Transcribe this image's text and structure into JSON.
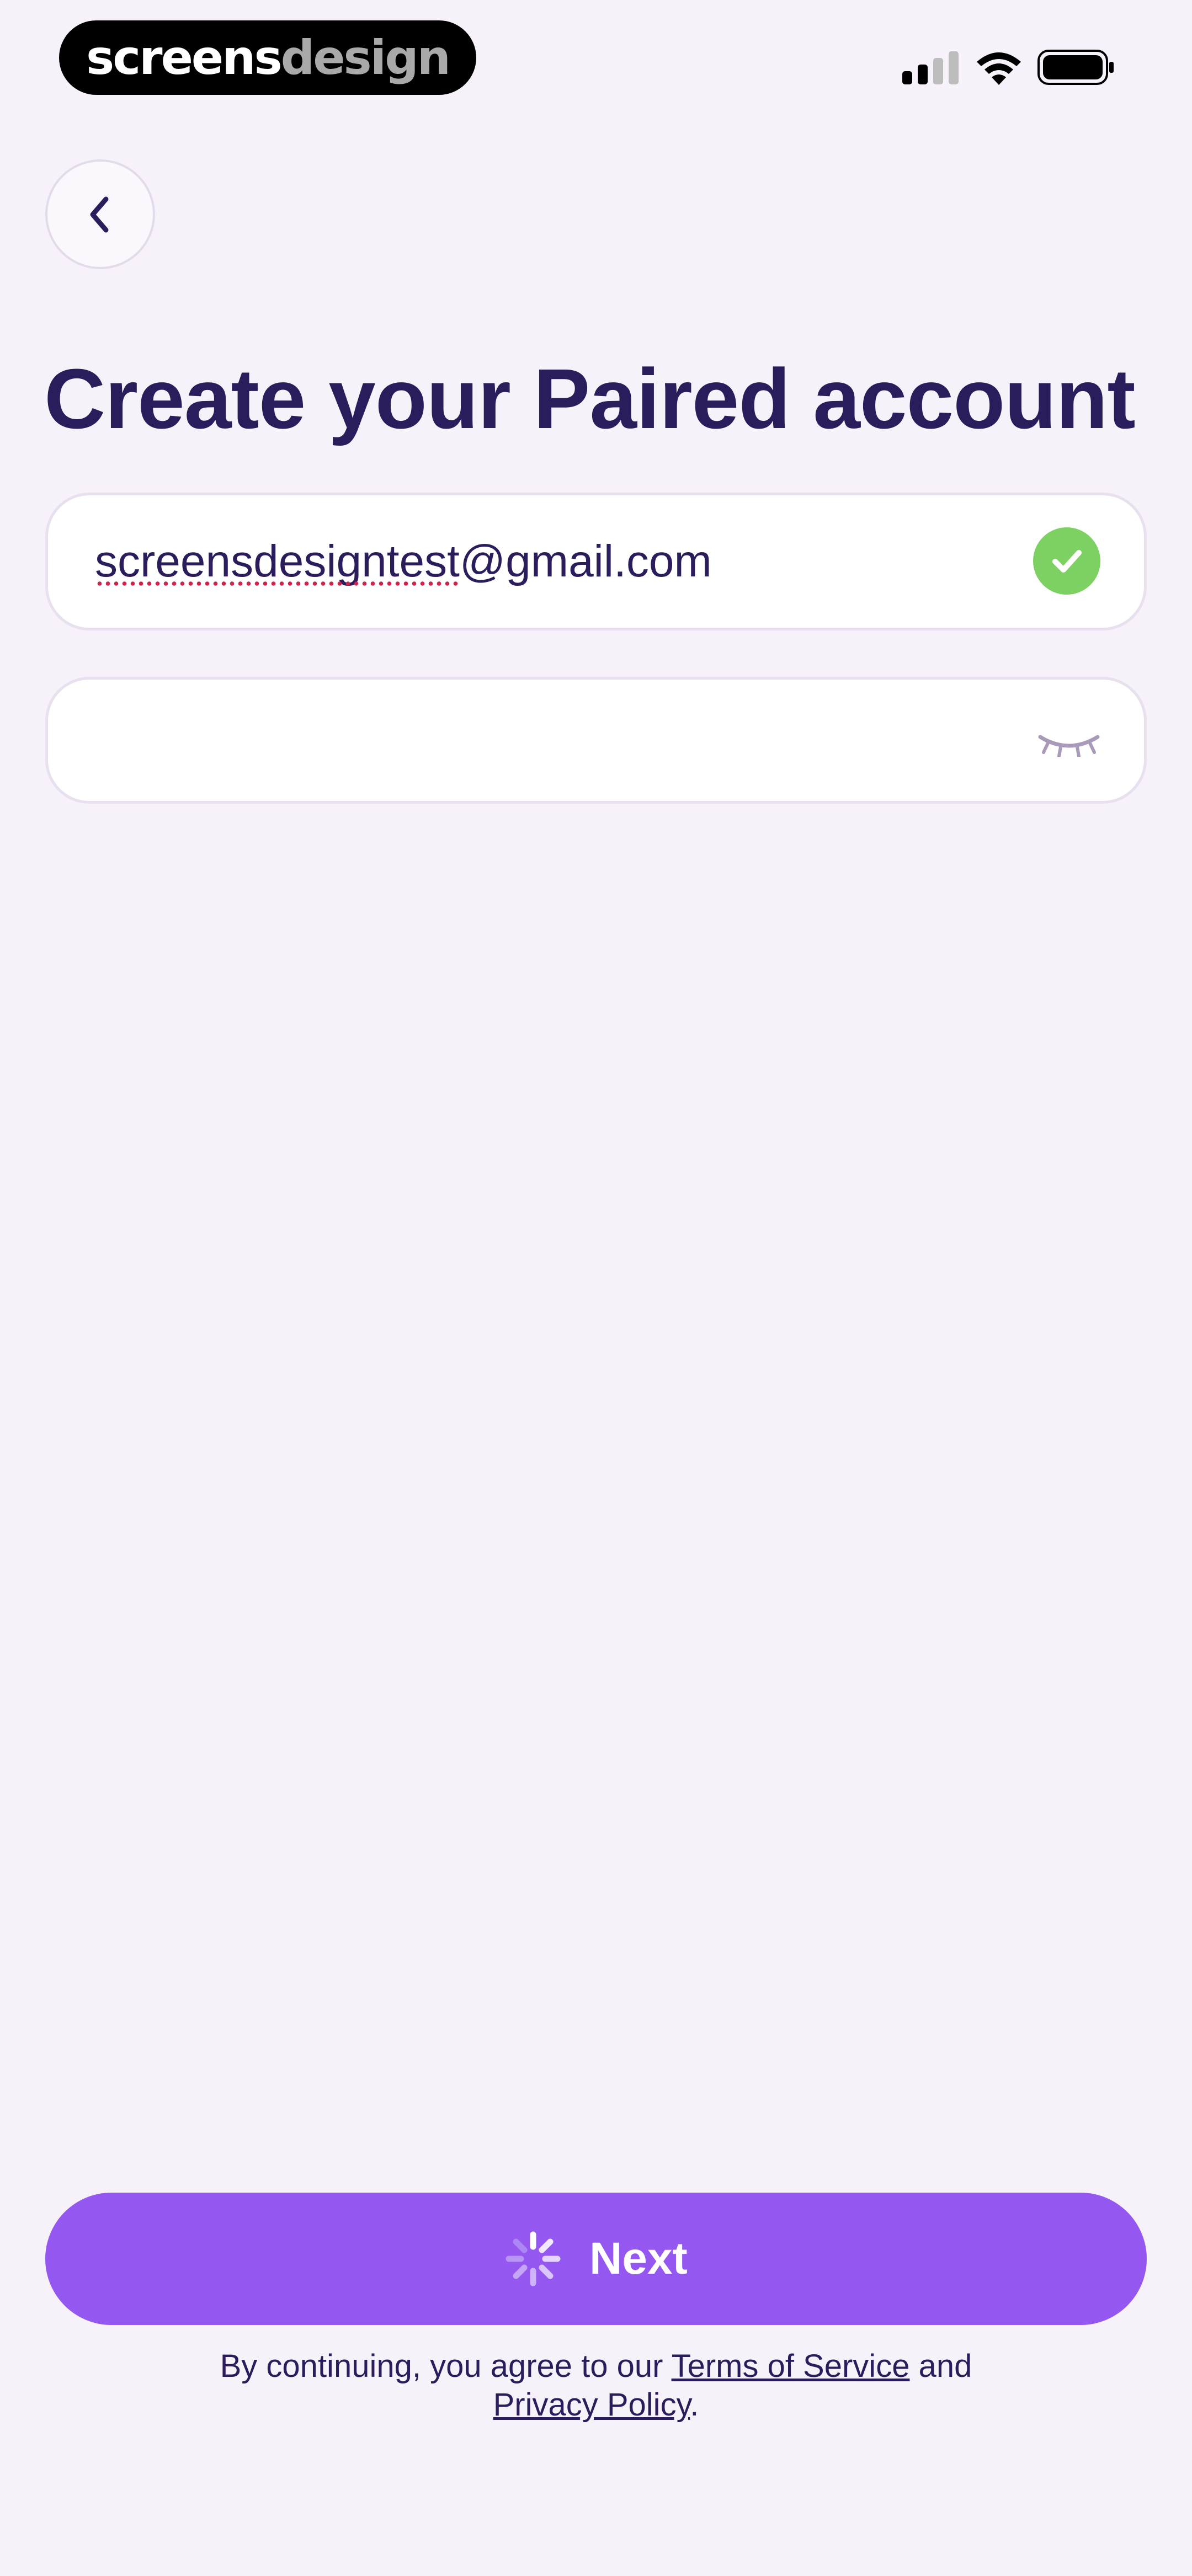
{
  "status_bar": {
    "brand_part1": "screens",
    "brand_part2": "design"
  },
  "header": {
    "title": "Create your Paired account"
  },
  "form": {
    "email_value": "screensdesigntest@gmail.com",
    "password_value": ""
  },
  "actions": {
    "next_label": "Next"
  },
  "legal": {
    "prefix": "By continuing, you agree to our",
    "terms_label": "Terms of Service",
    "and": "and",
    "privacy_label": "Privacy Policy",
    "suffix": "."
  },
  "colors": {
    "background": "#f7f2fa",
    "primary": "#9457f0",
    "title": "#2b1c5c",
    "success": "#7dd163"
  },
  "icons": {
    "back": "chevron-left-icon",
    "check": "check-circle-icon",
    "password_toggle": "eye-closed-icon",
    "spinner": "spinner-icon"
  }
}
